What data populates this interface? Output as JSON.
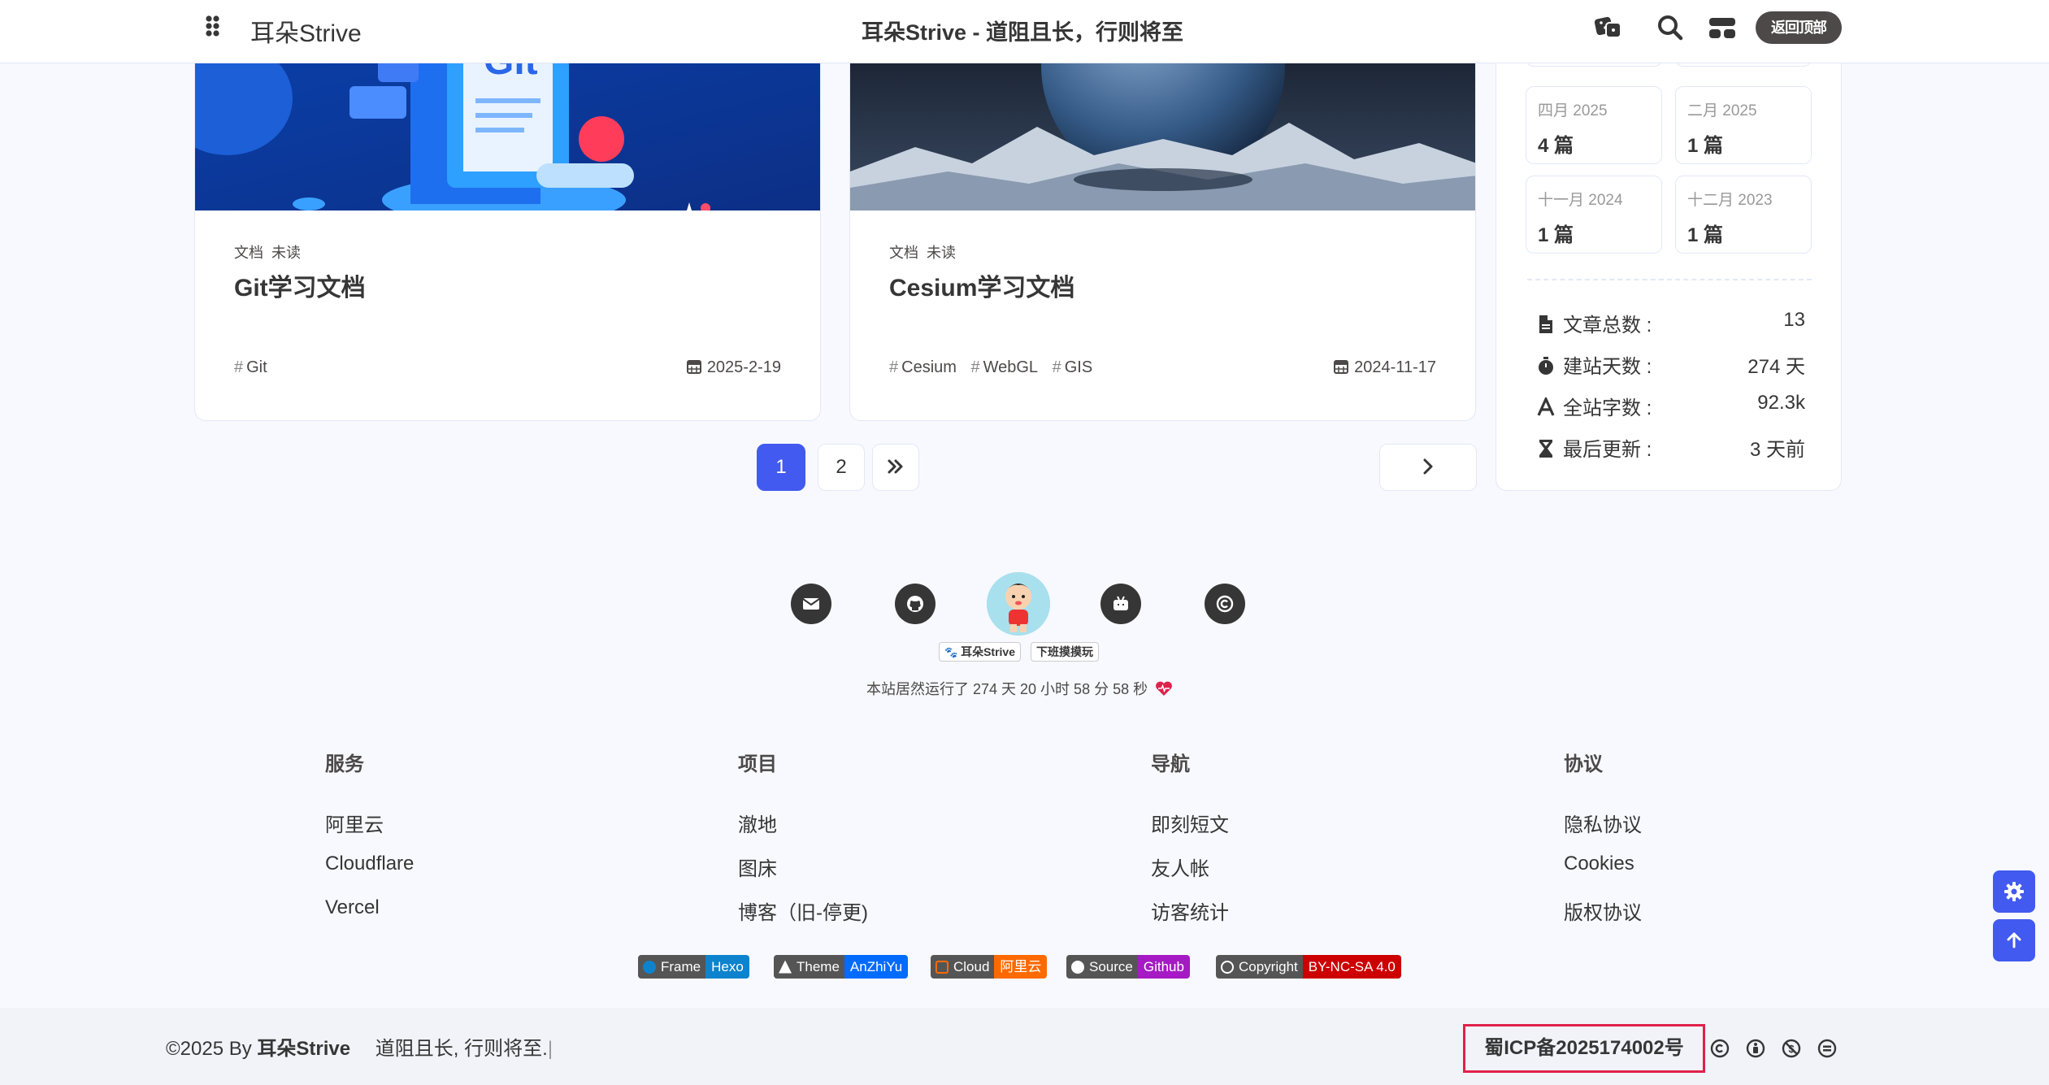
{
  "nav": {
    "brand": "耳朵Strive",
    "site_title": "耳朵Strive - 道阻且长，行则将至",
    "back_top": "返回顶部"
  },
  "posts": [
    {
      "cats": [
        "文档",
        "未读"
      ],
      "title": "Git学习文档",
      "tags": [
        "Git"
      ],
      "date": "2025-2-19",
      "cover_text": "Git"
    },
    {
      "cats": [
        "文档",
        "未读"
      ],
      "title": "Cesium学习文档",
      "tags": [
        "Cesium",
        "WebGL",
        "GIS"
      ],
      "date": "2024-11-17"
    }
  ],
  "pagination": {
    "pages": [
      "1",
      "2"
    ],
    "current": "1"
  },
  "archives": [
    {
      "month": "四月 2025",
      "count": "4 篇"
    },
    {
      "month": "二月 2025",
      "count": "1 篇"
    },
    {
      "month": "十一月 2024",
      "count": "1 篇"
    },
    {
      "month": "十二月 2023",
      "count": "1 篇"
    }
  ],
  "stats": [
    {
      "icon": "file-icon",
      "label": "文章总数 :",
      "value": "13"
    },
    {
      "icon": "stopwatch-icon",
      "label": "建站天数 :",
      "value": "274 天"
    },
    {
      "icon": "font-icon",
      "label": "全站字数 :",
      "value": "92.3k"
    },
    {
      "icon": "hourglass-icon",
      "label": "最后更新 :",
      "value": "3 天前"
    }
  ],
  "footer": {
    "badges": [
      "耳朵Strive",
      "下班摸摸玩"
    ],
    "runtime": "本站居然运行了 274 天 20 小时 58 分 58 秒",
    "columns": [
      {
        "title": "服务",
        "links": [
          "阿里云",
          "Cloudflare",
          "Vercel"
        ]
      },
      {
        "title": "项目",
        "links": [
          "澈地",
          "图床",
          "博客（旧-停更)"
        ]
      },
      {
        "title": "导航",
        "links": [
          "即刻短文",
          "友人帐",
          "访客统计"
        ]
      },
      {
        "title": "协议",
        "links": [
          "隐私协议",
          "Cookies",
          "版权协议"
        ]
      }
    ],
    "shields": [
      {
        "label": "Frame",
        "value": "Hexo",
        "color": "#0e83cd"
      },
      {
        "label": "Theme",
        "value": "AnZhiYu",
        "color": "#006bff"
      },
      {
        "label": "Cloud",
        "value": "阿里云",
        "color": "#ff6a00"
      },
      {
        "label": "Source",
        "value": "Github",
        "color": "#a51ac4"
      },
      {
        "label": "Copyright",
        "value": "BY-NC-SA 4.0",
        "color": "#c00"
      }
    ]
  },
  "bottom": {
    "copyright": "©2025 By",
    "author": "耳朵Strive",
    "motto": "道阻且长, 行则将至.",
    "icp": "蜀ICP备2025174002号"
  },
  "colors": {
    "accent": "#425aef",
    "icp_border": "#e0214b",
    "heart": "#e0214b"
  }
}
